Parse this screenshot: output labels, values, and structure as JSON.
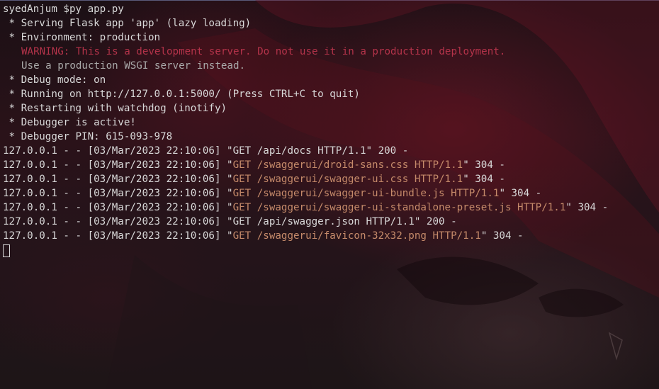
{
  "prompt": {
    "user": "syedAnjum",
    "symbol": "$",
    "command": "py app.py"
  },
  "startup": [
    " * Serving Flask app 'app' (lazy loading)",
    " * Environment: production"
  ],
  "warning": "WARNING: This is a development server. Do not use it in a production deployment.",
  "warning_hint": "Use a production WSGI server instead.",
  "status": [
    " * Debug mode: on",
    " * Running on http://127.0.0.1:5000/ (Press CTRL+C to quit)",
    " * Restarting with watchdog (inotify)",
    " * Debugger is active!",
    " * Debugger PIN: 615-093-978"
  ],
  "requests": [
    {
      "prefix": "127.0.0.1 - - [03/Mar/2023 22:10:06] \"",
      "request": "GET /api/docs HTTP/1.1",
      "suffix": "\" 200 -"
    },
    {
      "prefix": "127.0.0.1 - - [03/Mar/2023 22:10:06] \"",
      "request": "GET /swaggerui/droid-sans.css HTTP/1.1",
      "suffix": "\" 304 -"
    },
    {
      "prefix": "127.0.0.1 - - [03/Mar/2023 22:10:06] \"",
      "request": "GET /swaggerui/swagger-ui.css HTTP/1.1",
      "suffix": "\" 304 -"
    },
    {
      "prefix": "127.0.0.1 - - [03/Mar/2023 22:10:06] \"",
      "request": "GET /swaggerui/swagger-ui-bundle.js HTTP/1.1",
      "suffix": "\" 304 -"
    },
    {
      "prefix": "127.0.0.1 - - [03/Mar/2023 22:10:06] \"",
      "request": "GET /swaggerui/swagger-ui-standalone-preset.js HTTP/1.1",
      "suffix": "\" 304 -"
    },
    {
      "prefix": "127.0.0.1 - - [03/Mar/2023 22:10:06] \"",
      "request": "GET /api/swagger.json HTTP/1.1",
      "suffix": "\" 200 -"
    },
    {
      "prefix": "127.0.0.1 - - [03/Mar/2023 22:10:06] \"",
      "request": "GET /swaggerui/favicon-32x32.png HTTP/1.1",
      "suffix": "\" 304 -"
    }
  ],
  "colors": {
    "text": "#d8d8d8",
    "warning": "#b4334a",
    "muted": "#a9a9a9",
    "static_asset": "#c58a6a"
  }
}
